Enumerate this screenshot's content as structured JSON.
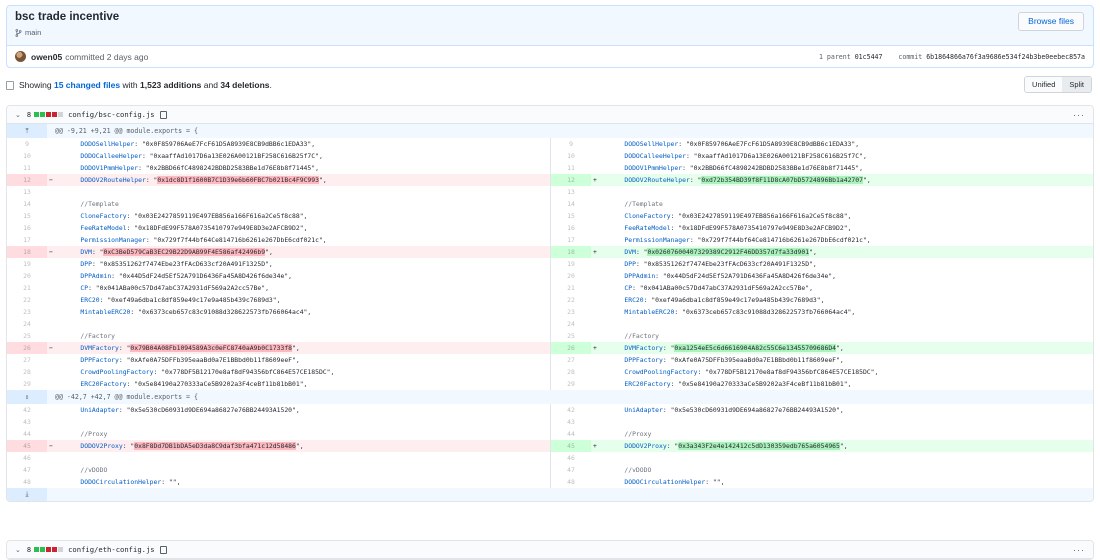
{
  "commit": {
    "title": "bsc trade incentive",
    "branch": "main",
    "browse_label": "Browse files",
    "author": "owen05",
    "committed_text": "committed 2 days ago",
    "parent_label": "1 parent",
    "parent_sha": "01c5447",
    "commit_label": "commit",
    "commit_sha": "6b1864866a76f3a9686e534f24b3be0eebec857a"
  },
  "summary": {
    "showing": "Showing",
    "changed_files": "15 changed files",
    "with": "with",
    "additions": "1,523 additions",
    "and": "and",
    "deletions": "34 deletions",
    "period": ".",
    "unified_label": "Unified",
    "split_label": "Split"
  },
  "files": [
    {
      "count": "8",
      "name": "config/bsc-config.js",
      "hunks": [
        {
          "header": "@@ -9,21 +9,21 @@ module.exports = {",
          "rows": [
            {
              "ln": "9",
              "rn": "9",
              "type": "ctx",
              "key": "DODOSellHelper",
              "val": "\"0x0F859706AeE7FcF61D5A8939E8CB9dBB6c1EDA33\","
            },
            {
              "ln": "10",
              "rn": "10",
              "type": "ctx",
              "key": "DODOCalleeHelper",
              "val": "\"0xaaffAd1017D6a13E026A00121BF258C616B25f7C\","
            },
            {
              "ln": "11",
              "rn": "11",
              "type": "ctx",
              "key": "DODOV1PmmHelper",
              "val": "\"0x2BBD66fC4898242BDBD2583BBe1d76E8b8f71445\","
            },
            {
              "ln": "12",
              "rn": "12",
              "type": "chg",
              "key": "DODOV2RouteHelper",
              "lval": "0x1dc8D1f1600B7C1D39e6b60FBC7b021Bc4F9C993",
              "rval": "0xd72b354BD39f8F11D8cA07bD5724896Bb1a42707"
            },
            {
              "ln": "13",
              "rn": "13",
              "type": "ctx",
              "key": "",
              "val": ""
            },
            {
              "ln": "14",
              "rn": "14",
              "type": "comment",
              "val": "//Template"
            },
            {
              "ln": "15",
              "rn": "15",
              "type": "ctx",
              "key": "CloneFactory",
              "val": "\"0x03E2427859119E497EB856a166F616a2Ce5f8c88\","
            },
            {
              "ln": "16",
              "rn": "16",
              "type": "ctx",
              "key": "FeeRateModel",
              "val": "\"0x18DFdE99F578A0735410797e949E8D3e2AFCB9D2\","
            },
            {
              "ln": "17",
              "rn": "17",
              "type": "ctx",
              "key": "PermissionManager",
              "val": "\"0x729f7f44bf64Ce814716b6261e267DbE6cdf021c\","
            },
            {
              "ln": "18",
              "rn": "18",
              "type": "chg",
              "key": "DVM",
              "lval": "0xC3BeD579CaB3EC29B22D9AB99F4E586af42496b9",
              "rval": "0x02607600407329389C2912F46DD357d7fa33d901"
            },
            {
              "ln": "19",
              "rn": "19",
              "type": "ctx",
              "key": "DPP",
              "val": "\"0x85351262f7474Ebe23fFAcD633cf20A491F1325D\","
            },
            {
              "ln": "20",
              "rn": "20",
              "type": "ctx",
              "key": "DPPAdmin",
              "val": "\"0x44D5dF24d5Ef52A791D6436Fa45A8D426f6de34e\","
            },
            {
              "ln": "21",
              "rn": "21",
              "type": "ctx",
              "key": "CP",
              "val": "\"0x041ABa00c57Dd47abC37A2931dF569a2A2cc57Be\","
            },
            {
              "ln": "22",
              "rn": "22",
              "type": "ctx",
              "key": "ERC20",
              "val": "\"0xef49a6dba1c8df859e49c17e9a485b439c7689d3\","
            },
            {
              "ln": "23",
              "rn": "23",
              "type": "ctx",
              "key": "MintableERC20",
              "val": "\"0x6373ceb657c83c91088d328622573fb766064ac4\","
            },
            {
              "ln": "24",
              "rn": "24",
              "type": "ctx",
              "key": "",
              "val": ""
            },
            {
              "ln": "25",
              "rn": "25",
              "type": "comment",
              "val": "//Factory"
            },
            {
              "ln": "26",
              "rn": "26",
              "type": "chg",
              "key": "DVMFactory",
              "lval": "0x79B04A08Fb1094589A3c0eFC8740aA9b0C1733f8",
              "rval": "0xa1254eE5c6d6616904A82c55C6e13455709686D4"
            },
            {
              "ln": "27",
              "rn": "27",
              "type": "ctx",
              "key": "DPPFactory",
              "val": "\"0xAfe0A75DFFb395eaaBd0a7E1BBbd0b11f8609eeF\","
            },
            {
              "ln": "28",
              "rn": "28",
              "type": "ctx",
              "key": "CrowdPoolingFactory",
              "val": "\"0x778DF5B12170e8af8dF94356bfC864E57CE185DC\","
            },
            {
              "ln": "29",
              "rn": "29",
              "type": "ctx",
              "key": "ERC20Factory",
              "val": "\"0x5e84190a270333aCe5B9202a3F4ceBf11b81bB01\","
            }
          ]
        },
        {
          "header": "@@ -42,7 +42,7 @@ module.exports = {",
          "rows": [
            {
              "ln": "42",
              "rn": "42",
              "type": "ctx",
              "key": "UniAdapter",
              "val": "\"0x5e530cD60931d9DE694a86827e76BB24493A1520\","
            },
            {
              "ln": "43",
              "rn": "43",
              "type": "ctx",
              "key": "",
              "val": ""
            },
            {
              "ln": "44",
              "rn": "44",
              "type": "comment",
              "val": "//Proxy"
            },
            {
              "ln": "45",
              "rn": "45",
              "type": "chg",
              "key": "DODOV2Proxy",
              "lval": "0x8F8Dd7DB1bDA5eD3da8C9daf3bfa471c12d58486",
              "rval": "0x3a343F2e4e142412c5dD130359edb765a6054965"
            },
            {
              "ln": "46",
              "rn": "46",
              "type": "ctx",
              "key": "",
              "val": ""
            },
            {
              "ln": "47",
              "rn": "47",
              "type": "comment",
              "val": "//vDODO"
            },
            {
              "ln": "48",
              "rn": "48",
              "type": "ctx",
              "key": "DODOCirculationHelper",
              "val": "\"\","
            }
          ]
        }
      ]
    },
    {
      "count": "8",
      "name": "config/eth-config.js"
    }
  ],
  "icons": {
    "chevron": "chevron-down-icon",
    "copy": "clipboard-icon",
    "expand": "unfold-icon",
    "more": "kebab-horizontal-icon"
  },
  "colors": {
    "add_bg": "#e6ffed",
    "del_bg": "#ffeef0",
    "add_hl": "#acf2bd",
    "del_hl": "#fdb8c0",
    "link": "#0366d6"
  }
}
